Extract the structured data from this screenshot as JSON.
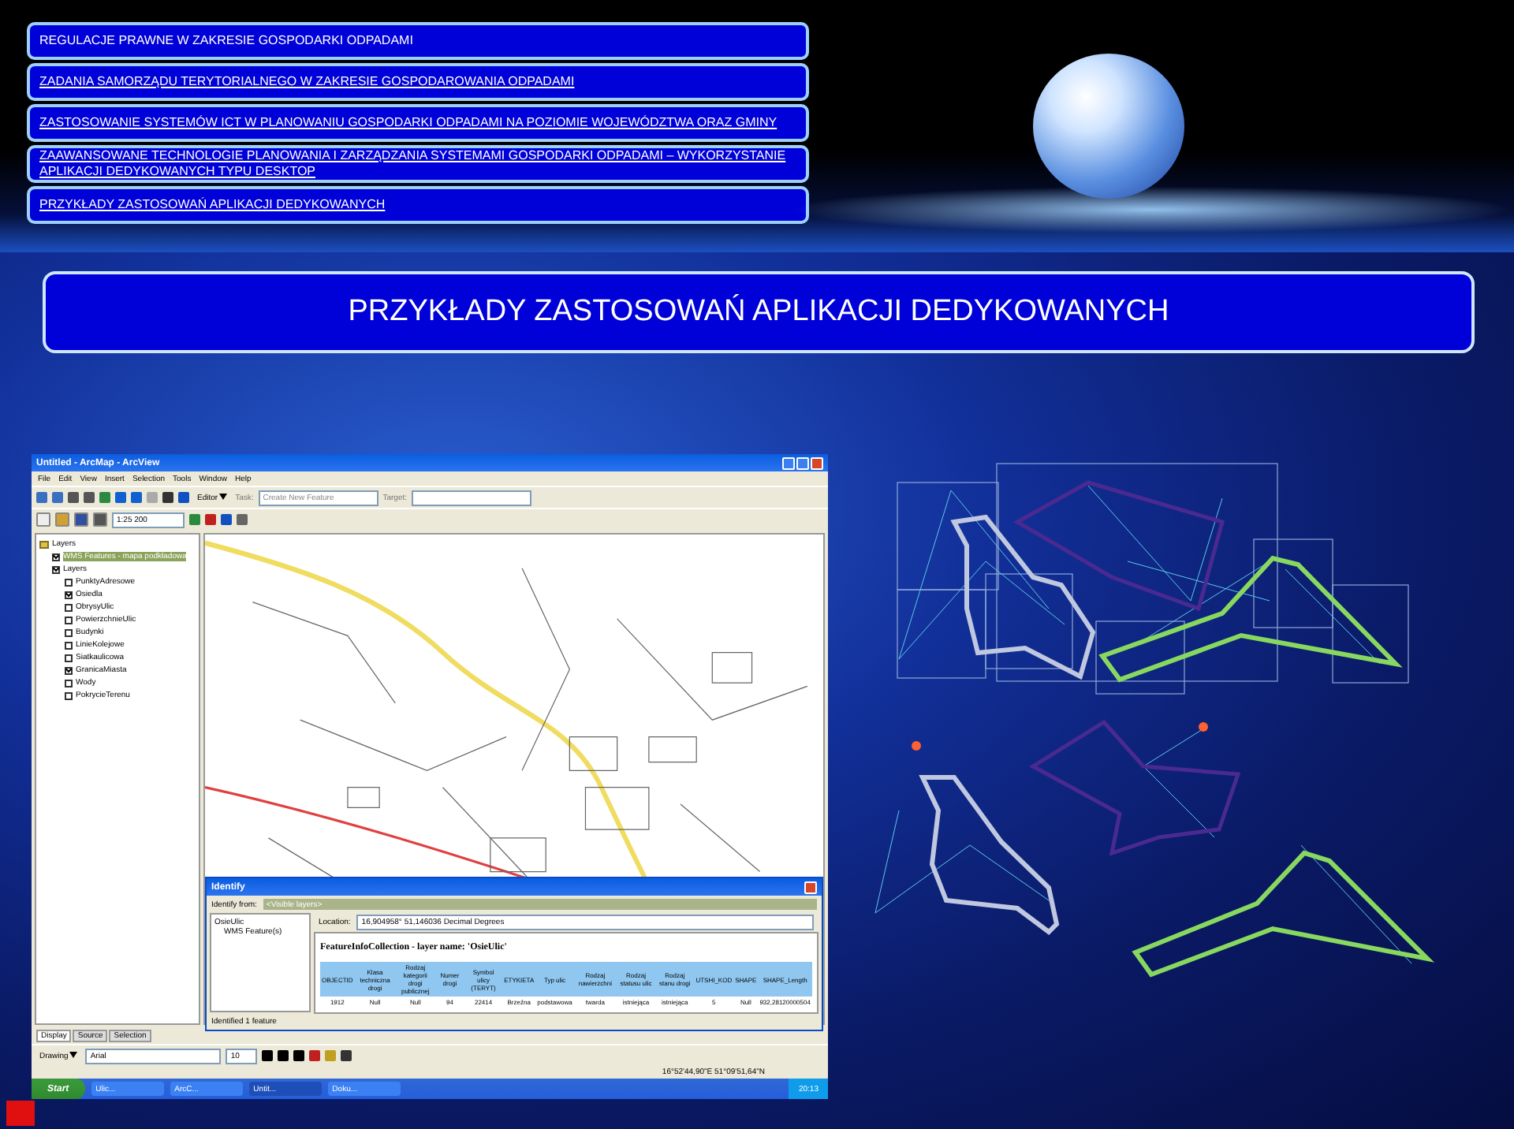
{
  "nav": [
    {
      "label": "REGULACJE PRAWNE W ZAKRESIE GOSPODARKI ODPADAMI",
      "link": false
    },
    {
      "label": "ZADANIA SAMORZĄDU TERYTORIALNEGO W ZAKRESIE GOSPODAROWANIA ODPADAMI",
      "link": true
    },
    {
      "label": "ZASTOSOWANIE SYSTEMÓW ICT W PLANOWANIU GOSPODARKI ODPADAMI NA POZIOMIE WOJEWÓDZTWA ORAZ GMINY",
      "link": true
    },
    {
      "label": "ZAAWANSOWANE TECHNOLOGIE  PLANOWANIA I ZARZĄDZANIA SYSTEMAMI GOSPODARKI ODPADAMI – WYKORZYSTANIE APLIKACJI DEDYKOWANYCH TYPU DESKTOP",
      "link": true
    },
    {
      "label": "PRZYKŁADY ZASTOSOWAŃ APLIKACJI DEDYKOWANYCH",
      "link": true
    }
  ],
  "title": "PRZYKŁADY ZASTOSOWAŃ APLIKACJI DEDYKOWANYCH",
  "arcmap": {
    "title": "Untitled - ArcMap - ArcView",
    "menu": [
      "File",
      "Edit",
      "View",
      "Insert",
      "Selection",
      "Tools",
      "Window",
      "Help"
    ],
    "editor": "Editor",
    "task_label": "Task:",
    "task": "Create New Feature",
    "target_label": "Target:",
    "scale": "1:25 200",
    "toc": {
      "label": "Layers",
      "children": [
        {
          "label": "WMS Features - mapa podkładowa",
          "checked": true,
          "selected": true
        },
        {
          "label": "Layers",
          "checked": true,
          "selected": false,
          "children": [
            {
              "label": "PunktyAdresowe",
              "checked": false,
              "selected": false
            },
            {
              "label": "Osiedla",
              "checked": true,
              "selected": false
            },
            {
              "label": "ObrysyUlic",
              "checked": false,
              "selected": false
            },
            {
              "label": "PowierzchnieUlic",
              "checked": false,
              "selected": false
            },
            {
              "label": "Budynki",
              "checked": false,
              "selected": false
            },
            {
              "label": "LinieKolejowe",
              "checked": false,
              "selected": false
            },
            {
              "label": "Siatkaulicowa",
              "checked": false,
              "selected": false
            },
            {
              "label": "GranicaMiasta",
              "checked": true,
              "selected": false
            },
            {
              "label": "Wody",
              "checked": false,
              "selected": false
            },
            {
              "label": "PokrycieTerenu",
              "checked": false,
              "selected": false
            }
          ]
        }
      ]
    },
    "tabs": [
      {
        "label": "Display",
        "selected": true
      },
      {
        "label": "Source",
        "selected": false
      },
      {
        "label": "Selection",
        "selected": false
      }
    ],
    "drawing": "Drawing",
    "font": "Arial",
    "font_size": "10",
    "status": "16°52'44,90\"E  51°09'51,64\"N",
    "identify": {
      "title": "Identify",
      "from_label": "Identify from:",
      "from": "<Visible layers>",
      "tree": {
        "label": "OsieUlic",
        "children": [
          {
            "label": "WMS Feature(s)"
          }
        ]
      },
      "location_label": "Location:",
      "location": "16,904958° 51,146036 Decimal Degrees",
      "heading": "FeatureInfoCollection - layer name: 'OsieUlic'",
      "columns": [
        "OBJECTID",
        "Klasa techniczna drogi",
        "Rodzaj kategorii drogi publicznej",
        "Numer drogi",
        "Symbol ulicy (TERYT)",
        "ETYKIETA",
        "Typ ulic",
        "Rodzaj nawierzchni",
        "Rodzaj statusu ulic",
        "Rodzaj stanu drogi",
        "UTSHI_KOD",
        "SHAPE",
        "SHAPE_Length"
      ],
      "rows": [
        [
          "1912",
          "Null",
          "Null",
          "94",
          "22414",
          "Brzeźna",
          "podstawowa",
          "twarda",
          "istniejąca",
          "istniejąca",
          "5",
          "Null",
          "932,28120000504"
        ]
      ],
      "footer": "Identified 1 feature"
    },
    "taskbar": {
      "start": "Start",
      "items": [
        {
          "label": "Ulic...",
          "selected": false
        },
        {
          "label": "ArcC...",
          "selected": false
        },
        {
          "label": "Untit...",
          "selected": true
        },
        {
          "label": "Doku...",
          "selected": false
        }
      ],
      "time": "20:13"
    }
  }
}
